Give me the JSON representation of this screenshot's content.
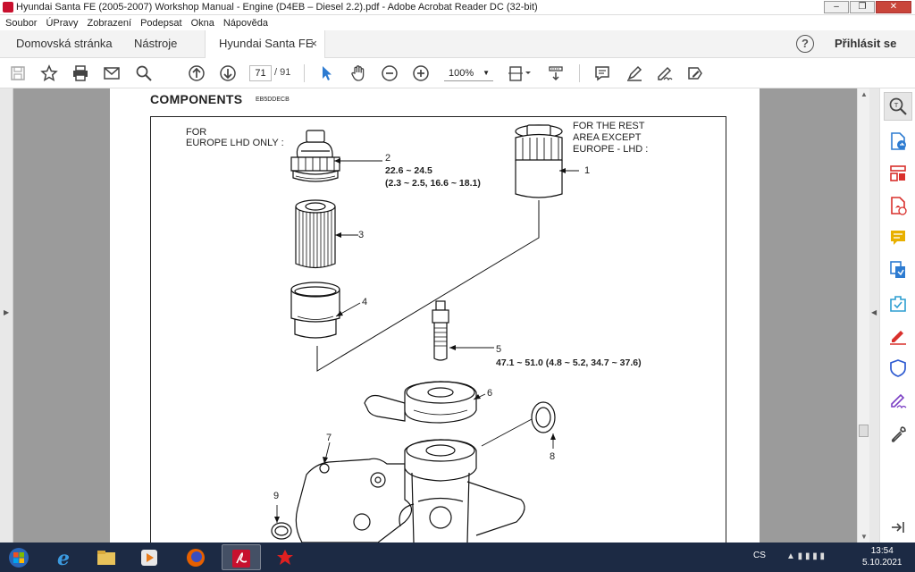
{
  "window": {
    "title": "Hyundai Santa FE (2005-2007) Workshop Manual - Engine (D4EB – Diesel 2.2).pdf - Adobe Acrobat Reader DC (32-bit)"
  },
  "menu": [
    "Soubor",
    "ÚPravy",
    "Zobrazení",
    "Podepsat",
    "Okna",
    "Nápověda"
  ],
  "tabs": {
    "home": "Domovská stránka",
    "tools": "Nástroje",
    "document": "Hyundai Santa FE (...",
    "close": "×",
    "help": "?",
    "login": "Přihlásit se"
  },
  "toolbar": {
    "page_current": "71",
    "page_total": "/ 91",
    "zoom": "100%"
  },
  "document": {
    "heading": "COMPONENTS",
    "code": "EB5DDECB",
    "label_left_1": "FOR",
    "label_left_2": "EUROPE LHD ONLY :",
    "label_right_1": "FOR THE REST",
    "label_right_2": "AREA EXCEPT",
    "label_right_3": "EUROPE - LHD :",
    "num_1": "1",
    "num_2": "2",
    "num_3": "3",
    "num_4": "4",
    "num_5": "5",
    "num_6": "6",
    "num_7": "7",
    "num_8": "8",
    "num_9": "9",
    "torque_2a": "22.6 ~ 24.5",
    "torque_2b": "(2.3 ~ 2.5, 16.6 ~ 18.1)",
    "torque_5": "47.1 ~ 51.0 (4.8 ~ 5.2, 34.7 ~ 37.6)"
  },
  "taskbar": {
    "language": "CS",
    "time": "13:54",
    "date": "5.10.2021"
  },
  "colors": {
    "acrobat_red": "#c8102e",
    "tool_red": "#d9302c",
    "tool_blue": "#2d7bd1",
    "tool_purple": "#7b3fc4",
    "tool_yellow": "#e8b000",
    "taskbar": "#1c2a44",
    "viewer_bg": "#9b9b9b"
  }
}
